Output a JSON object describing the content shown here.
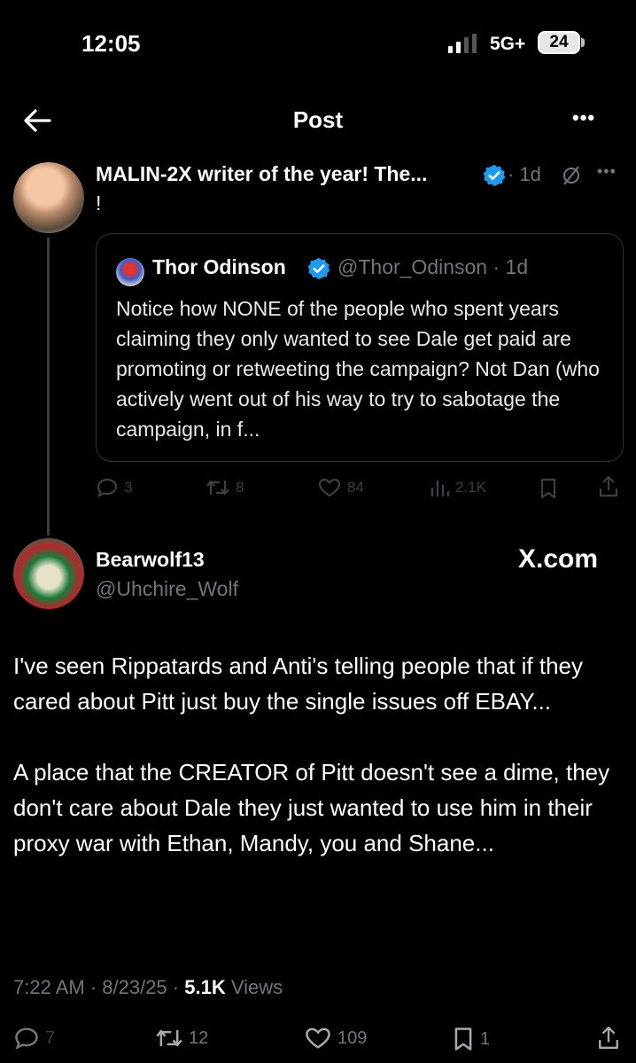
{
  "status_bar": {
    "time": "12:05",
    "network": "5G+",
    "battery": "24"
  },
  "nav": {
    "title": "Post"
  },
  "post1": {
    "author": "MALIN-2X writer of the year! The...",
    "time": "· 1d",
    "text": "!"
  },
  "quote": {
    "name": "Thor Odinson",
    "handle": "@Thor_Odinson · 1d",
    "text": "Notice how NONE of the people who spent years claiming they only wanted to see Dale get paid are promoting or retweeting the campaign? Not Dan (who actively went out of his way to try to sabotage the campaign, in f..."
  },
  "post1_actions": {
    "replies": "3",
    "retweets": "8",
    "likes": "84",
    "views": "2.1K"
  },
  "post2": {
    "name": "Bearwolf13",
    "handle": "@Uhchire_Wolf",
    "brand": "X.com",
    "paragraph1": "I've seen Rippatards and Anti's telling people that if they cared about Pitt just buy the single issues off EBAY...",
    "paragraph2": "A place that the CREATOR of Pitt doesn't see a dime, they don't care about Dale they just wanted to use him in their proxy war with Ethan, Mandy, you and Shane...",
    "meta_date": "7:22 AM · 8/23/25 · ",
    "meta_views": "5.1K",
    "meta_views_label": " Views"
  },
  "post2_actions": {
    "replies": "7",
    "retweets": "12",
    "likes": "109",
    "bookmarks": "1"
  },
  "colors": {
    "background": "#000000",
    "verified": "#1d9bf0",
    "muted": "#71767b",
    "faint": "#3a4044"
  }
}
